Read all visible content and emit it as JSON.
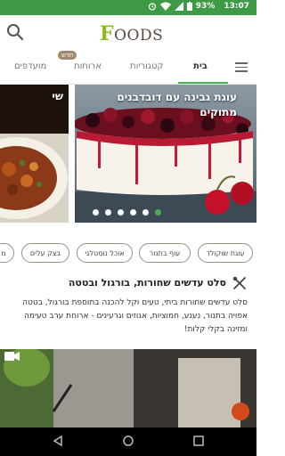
{
  "status_bar": {
    "battery": "93%",
    "time": "13:07"
  },
  "header": {
    "logo_first": "F",
    "logo_rest": "OODS"
  },
  "tabs": [
    {
      "label": "בית",
      "active": true
    },
    {
      "label": "קטגוריות",
      "active": false
    },
    {
      "label": "ארוחות",
      "active": false,
      "badge": "חדש"
    },
    {
      "label": "מועדפים",
      "active": false
    }
  ],
  "carousel": {
    "main_title": "עוגת גבינה עם דובדבנים מתוקים",
    "left_title": "שי",
    "dot_count": 6,
    "active_dot": 5
  },
  "chips": [
    "עוגת שוקולד",
    "עוף בתנור",
    "אוכל נוסטלגי",
    "בצק עלים",
    "מ"
  ],
  "recipe": {
    "title": "סלט עדשים שחורות, בורגול ובטטה",
    "description": "סלט עדשים שחורות ביתי, טעים וקל להכנה בתוספת בורגול, בטטה אפויה בתנור, נענע, חמוציות, אגוזים וגרעינים - ארוחת ערב טעימה ומזינה בקלי קלות!"
  },
  "colors": {
    "status_bar": "#3f9a45",
    "accent": "#4caf50",
    "chip_border": "#a09080"
  }
}
